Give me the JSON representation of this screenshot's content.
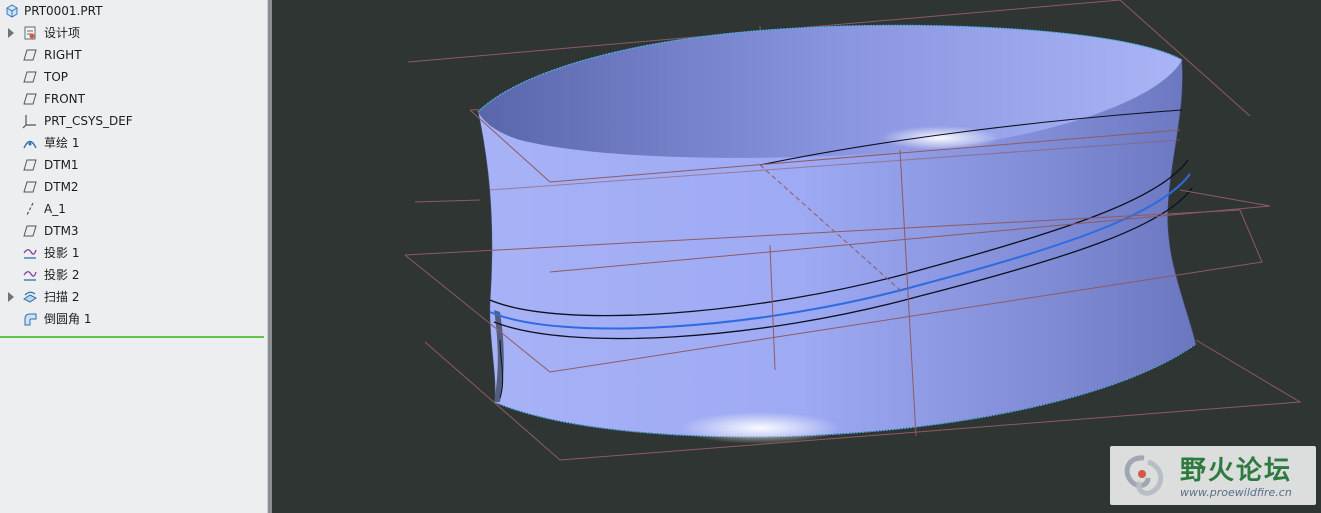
{
  "model_tree": {
    "root": {
      "label": "PRT0001.PRT",
      "icon": "part-icon"
    },
    "items": [
      {
        "label": "设计项",
        "icon": "design-items-icon",
        "expandable": true
      },
      {
        "label": "RIGHT",
        "icon": "datum-plane-icon",
        "expandable": false
      },
      {
        "label": "TOP",
        "icon": "datum-plane-icon",
        "expandable": false
      },
      {
        "label": "FRONT",
        "icon": "datum-plane-icon",
        "expandable": false
      },
      {
        "label": "PRT_CSYS_DEF",
        "icon": "coordinate-system-icon",
        "expandable": false
      },
      {
        "label": "草绘 1",
        "icon": "sketch-icon",
        "expandable": false
      },
      {
        "label": "DTM1",
        "icon": "datum-plane-icon",
        "expandable": false
      },
      {
        "label": "DTM2",
        "icon": "datum-plane-icon",
        "expandable": false
      },
      {
        "label": "A_1",
        "icon": "datum-axis-icon",
        "expandable": false
      },
      {
        "label": "DTM3",
        "icon": "datum-plane-icon",
        "expandable": false
      },
      {
        "label": "投影 1",
        "icon": "projection-curve-icon",
        "expandable": false
      },
      {
        "label": "投影 2",
        "icon": "projection-curve-icon",
        "expandable": false
      },
      {
        "label": "扫描 2",
        "icon": "sweep-icon",
        "expandable": true
      },
      {
        "label": "倒圆角 1",
        "icon": "round-icon",
        "expandable": false
      }
    ]
  },
  "watermark": {
    "title": "野火论坛",
    "url": "www.proewildfire.cn"
  },
  "colors": {
    "viewport_bg": "#2f3532",
    "surface": "#9ea9f2",
    "datum_plane": "#8e5a63",
    "tree_bg": "#eceeef",
    "insert_line": "#62c24a"
  }
}
